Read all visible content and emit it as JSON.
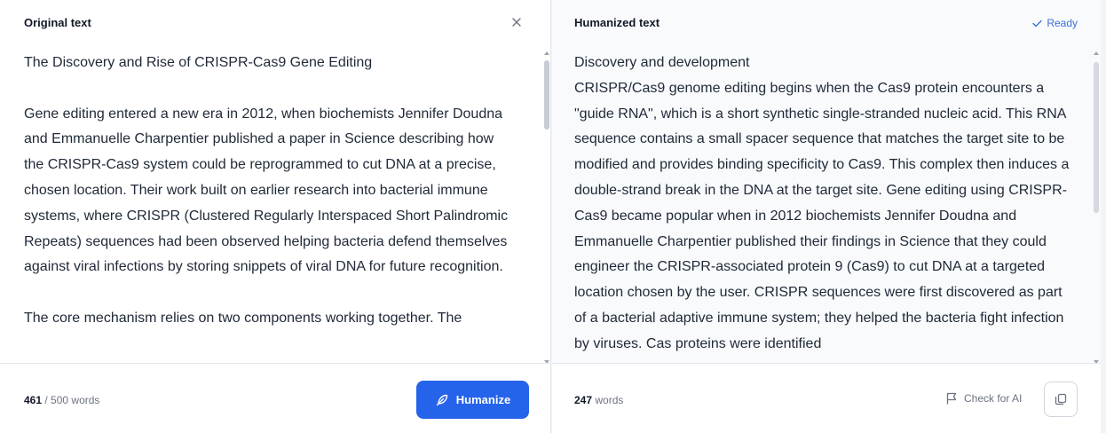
{
  "left": {
    "title": "Original text",
    "close_icon": "close-icon",
    "paragraphs": [
      "The Discovery and Rise of CRISPR-Cas9 Gene Editing",
      "Gene editing entered a new era in 2012, when biochemists Jennifer Doudna and Emmanuelle Charpentier published a paper in Science describing how the CRISPR-Cas9 system could be reprogrammed to cut DNA at a precise, chosen location. Their work built on earlier research into bacterial immune systems, where CRISPR (Clustered Regularly Interspaced Short Palindromic Repeats) sequences had been observed helping bacteria defend themselves against viral infections by storing snippets of viral DNA for future recognition.",
      "The core mechanism relies on two components working together. The"
    ],
    "word_count": "461",
    "word_limit": "/ 500 words",
    "humanize_label": "Humanize"
  },
  "right": {
    "title": "Humanized text",
    "status": "Ready",
    "text": "Discovery and development\nCRISPR/Cas9 genome editing begins when the Cas9 protein encounters a \"guide RNA\", which is a short synthetic single-stranded nucleic acid. This RNA sequence contains a small spacer sequence that matches the target site to be modified and provides binding specificity to Cas9. This complex then induces a double-strand break in the DNA at the target site. Gene editing using CRISPR-Cas9 became popular when in 2012 biochemists Jennifer Doudna and Emmanuelle Charpentier published their findings in Science that they could engineer the CRISPR-associated protein 9 (Cas9) to cut DNA at a targeted location chosen by the user. CRISPR sequences were first discovered as part of a bacterial adaptive immune system; they helped the bacteria fight infection by viruses. Cas proteins were identified",
    "word_count": "247",
    "word_unit": "words",
    "check_ai_label": "Check for AI"
  },
  "colors": {
    "accent": "#2563eb",
    "ready": "#3b6fd6"
  }
}
